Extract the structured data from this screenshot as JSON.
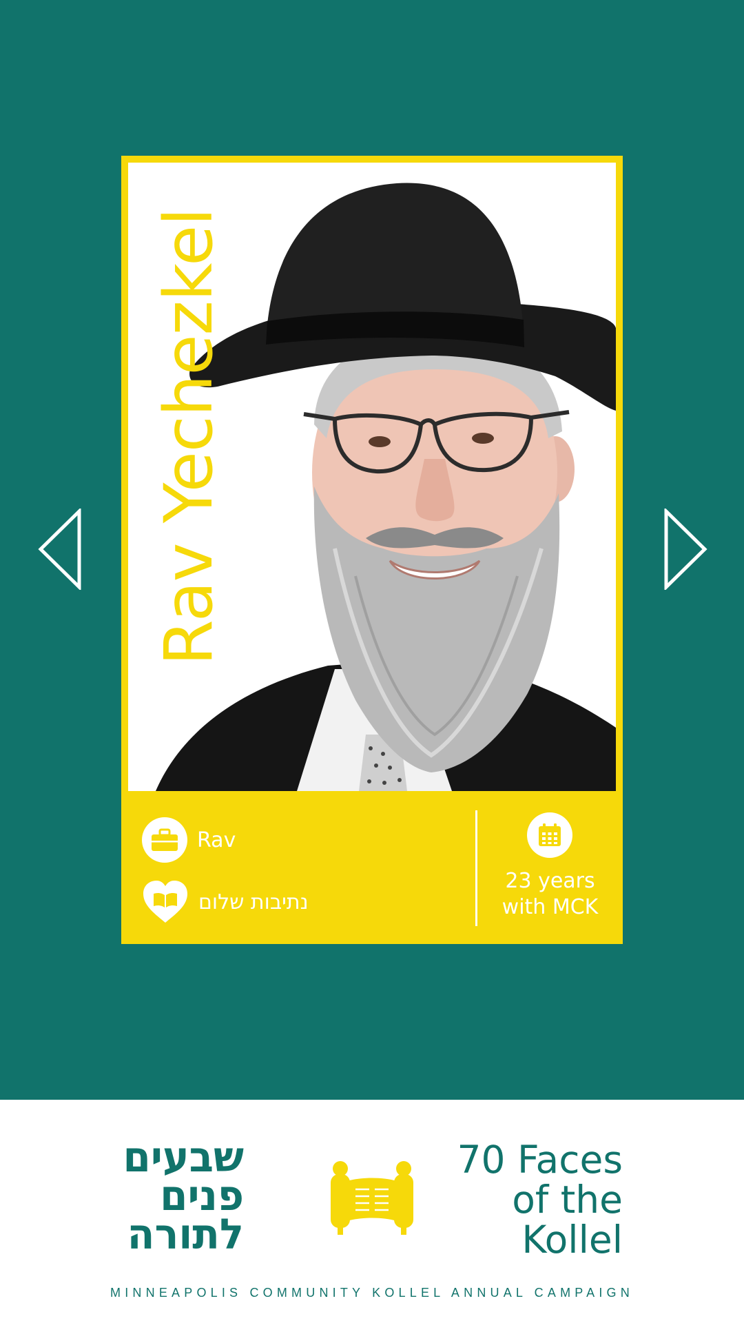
{
  "colors": {
    "background": "#11736b",
    "card": "#f6d90a",
    "footer": "#ffffff",
    "text_on_card": "#ffffff"
  },
  "navigation": {
    "prev_icon": "triangle-left-outline-icon",
    "next_icon": "triangle-right-outline-icon"
  },
  "profile": {
    "name": "Rav Yechezkel",
    "role": "Rav",
    "role_icon": "briefcase-icon",
    "program": "נתיבות שלום",
    "program_icon": "heart-book-icon",
    "tenure": "23 years",
    "tenure_suffix": "with MCK",
    "tenure_icon": "calendar-icon"
  },
  "footer": {
    "hebrew_title_lines": [
      "שבעים",
      "פנים",
      "לתורה"
    ],
    "scroll_icon": "torah-scroll-icon",
    "english_title_lines": [
      "70 Faces",
      "of the",
      "Kollel"
    ],
    "tagline": "MINNEAPOLIS COMMUNITY KOLLEL ANNUAL CAMPAIGN"
  }
}
